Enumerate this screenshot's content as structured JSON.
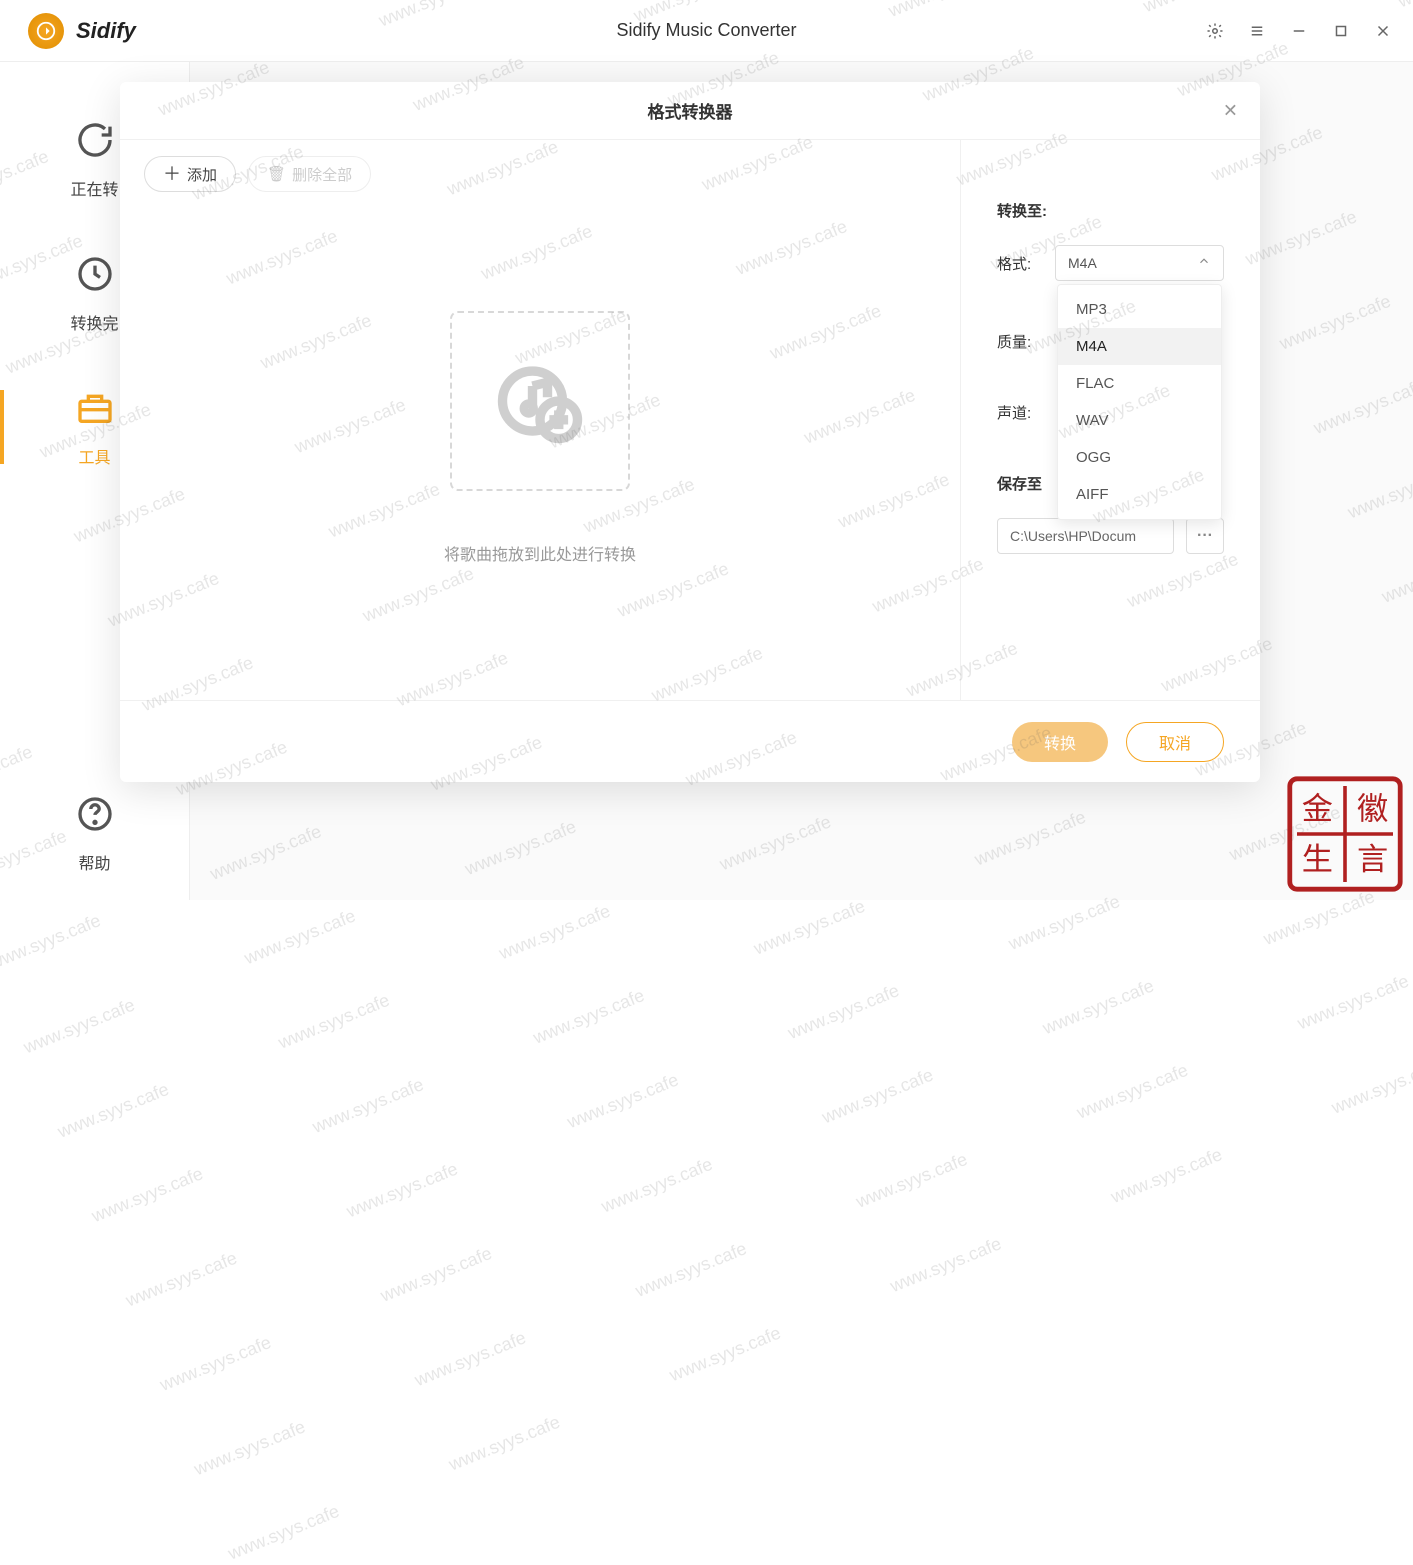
{
  "header": {
    "brand": "Sidify",
    "app_title": "Sidify Music Converter"
  },
  "sidebar": {
    "items": [
      {
        "label": "正在转"
      },
      {
        "label": "转换完"
      },
      {
        "label": "工具"
      },
      {
        "label": "帮助"
      }
    ]
  },
  "modal": {
    "title": "格式转换器",
    "add_label": "添加",
    "delete_all_label": "删除全部",
    "dropzone_hint": "将歌曲拖放到此处进行转换",
    "convert_section": "转换至:",
    "format_label": "格式:",
    "quality_label": "质量:",
    "channel_label": "声道:",
    "saveto_label": "保存至",
    "format_value": "M4A",
    "format_options": [
      "MP3",
      "M4A",
      "FLAC",
      "WAV",
      "OGG",
      "AIFF"
    ],
    "save_path": "C:\\Users\\HP\\Docum",
    "browse_label": "···",
    "convert_btn": "转换",
    "cancel_btn": "取消"
  },
  "watermark": "www.syys.cafe"
}
